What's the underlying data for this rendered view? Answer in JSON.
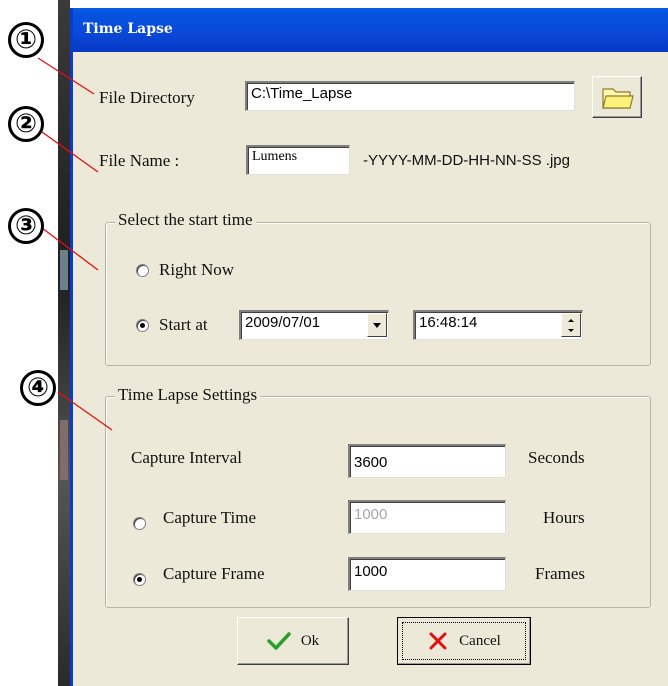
{
  "window": {
    "title": "Time Lapse"
  },
  "file": {
    "directory_label": "File Directory",
    "directory_value": "C:\\Time_Lapse",
    "name_label": "File Name :",
    "name_value": "Lumens",
    "name_suffix": "-YYYY-MM-DD-HH-NN-SS .jpg"
  },
  "start_group": {
    "title": "Select the start time",
    "right_now_label": "Right Now",
    "start_at_label": "Start at",
    "date_value": "2009/07/01",
    "time_value": "16:48:14",
    "selected": "start_at"
  },
  "settings_group": {
    "title": "Time Lapse Settings",
    "interval_label": "Capture Interval",
    "interval_value": "3600",
    "interval_unit": "Seconds",
    "time_label": "Capture Time",
    "time_value": "1000",
    "time_unit": "Hours",
    "frame_label": "Capture Frame",
    "frame_value": "1000",
    "frame_unit": "Frames",
    "selected": "capture_frame"
  },
  "buttons": {
    "ok_label": "Ok",
    "cancel_label": "Cancel"
  },
  "annotations": [
    "①",
    "②",
    "③",
    "④"
  ],
  "colors": {
    "title_bar": "#0a47d8",
    "dialog_bg": "#ece9d8",
    "annotation_line": "#e01010",
    "ok_check": "#2aa02a",
    "cancel_x": "#e01010"
  }
}
